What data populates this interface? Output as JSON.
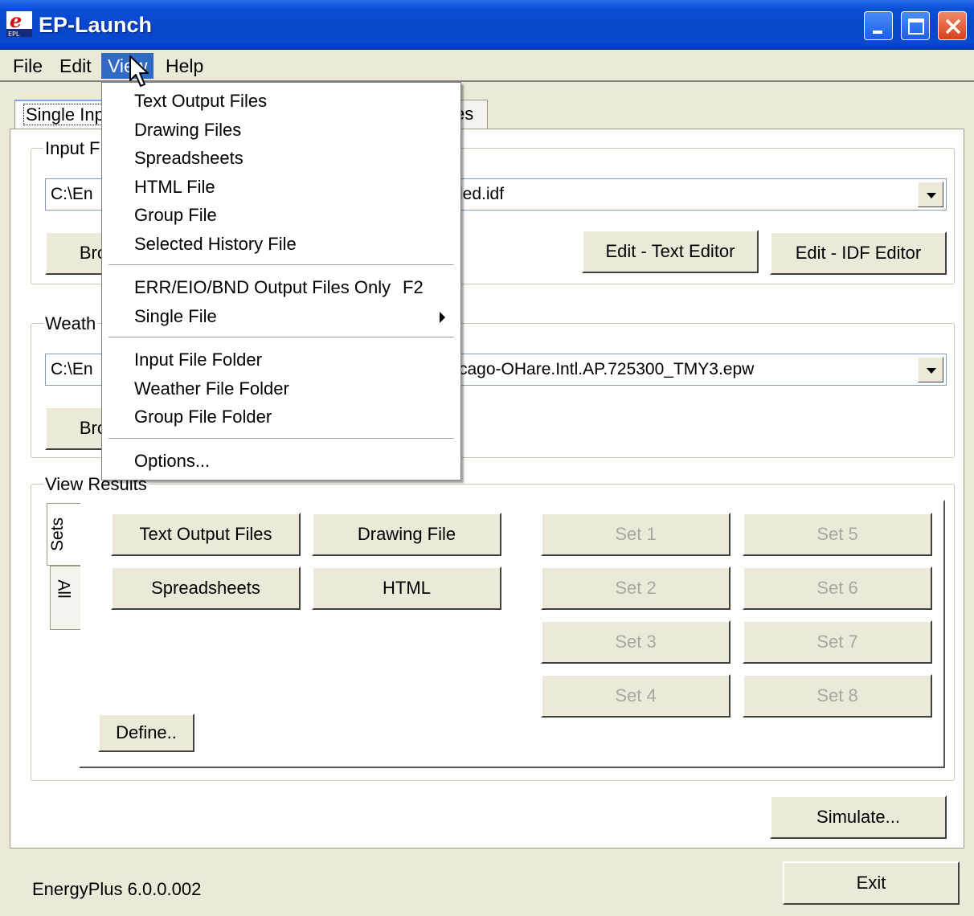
{
  "window": {
    "title": "EP-Launch",
    "icon": "energyplus-app-icon"
  },
  "menubar": {
    "file": "File",
    "edit": "Edit",
    "view": "View",
    "help": "Help"
  },
  "tabs": {
    "single": "Single Inp",
    "history": "es"
  },
  "input_file": {
    "group_label": "Input F",
    "path": "C:\\En",
    "path_tail": "led.idf",
    "browse": "Bro",
    "edit_text": "Edit - Text Editor",
    "edit_idf": "Edit - IDF Editor"
  },
  "weather_file": {
    "group_label": "Weath",
    "path": "C:\\En",
    "path_tail": "cago-OHare.Intl.AP.725300_TMY3.epw",
    "browse": "Bro"
  },
  "view_results": {
    "group_label": "View Results",
    "side_tabs": {
      "sets": "Sets",
      "all": "All"
    },
    "buttons": {
      "text_output": "Text Output Files",
      "drawing": "Drawing File",
      "spreadsheets": "Spreadsheets",
      "html": "HTML"
    },
    "sets": [
      "Set 1",
      "Set 2",
      "Set 3",
      "Set 4",
      "Set 5",
      "Set 6",
      "Set 7",
      "Set 8"
    ],
    "define": "Define.."
  },
  "simulate": "Simulate...",
  "exit": "Exit",
  "status": {
    "version": "EnergyPlus 6.0.0.002"
  },
  "view_menu": {
    "items": [
      "Text Output Files",
      "Drawing Files",
      "Spreadsheets",
      "HTML File",
      "Group File",
      "Selected History File",
      "ERR/EIO/BND Output Files Only",
      "Single File",
      "Input File Folder",
      "Weather File Folder",
      "Group File Folder",
      "Options..."
    ],
    "shortcut_err": "F2"
  },
  "colors": {
    "titlebar": "#0845c8",
    "menu_highlight": "#316ac5",
    "face": "#ece9d8",
    "close": "#d8401a"
  }
}
